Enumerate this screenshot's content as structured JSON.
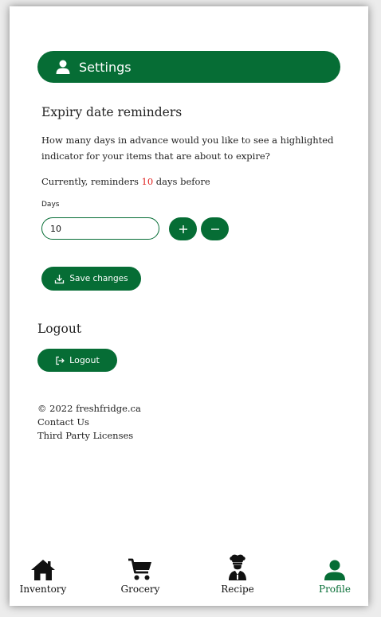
{
  "header": {
    "title": "Settings",
    "icon": "user-icon"
  },
  "reminders": {
    "title": "Expiry date reminders",
    "description": "How many days in advance would you like to see a highlighted indicator for your items that are about to expire?",
    "current_prefix": "Currently, reminders ",
    "current_value": "10",
    "current_suffix": " days before",
    "days_label": "Days",
    "days_value": "10",
    "save_label": "Save changes"
  },
  "logout": {
    "title": "Logout",
    "button_label": "Logout"
  },
  "footer": {
    "copyright": "© 2022 freshfridge.ca",
    "contact": "Contact Us",
    "licenses": "Third Party Licenses"
  },
  "nav": {
    "items": [
      {
        "label": "Inventory",
        "icon": "home-icon"
      },
      {
        "label": "Grocery",
        "icon": "cart-icon"
      },
      {
        "label": "Recipe",
        "icon": "chef-icon"
      },
      {
        "label": "Profile",
        "icon": "user-icon"
      }
    ],
    "active": "Profile"
  },
  "colors": {
    "brand": "#066d35",
    "highlight": "#e0201e"
  }
}
